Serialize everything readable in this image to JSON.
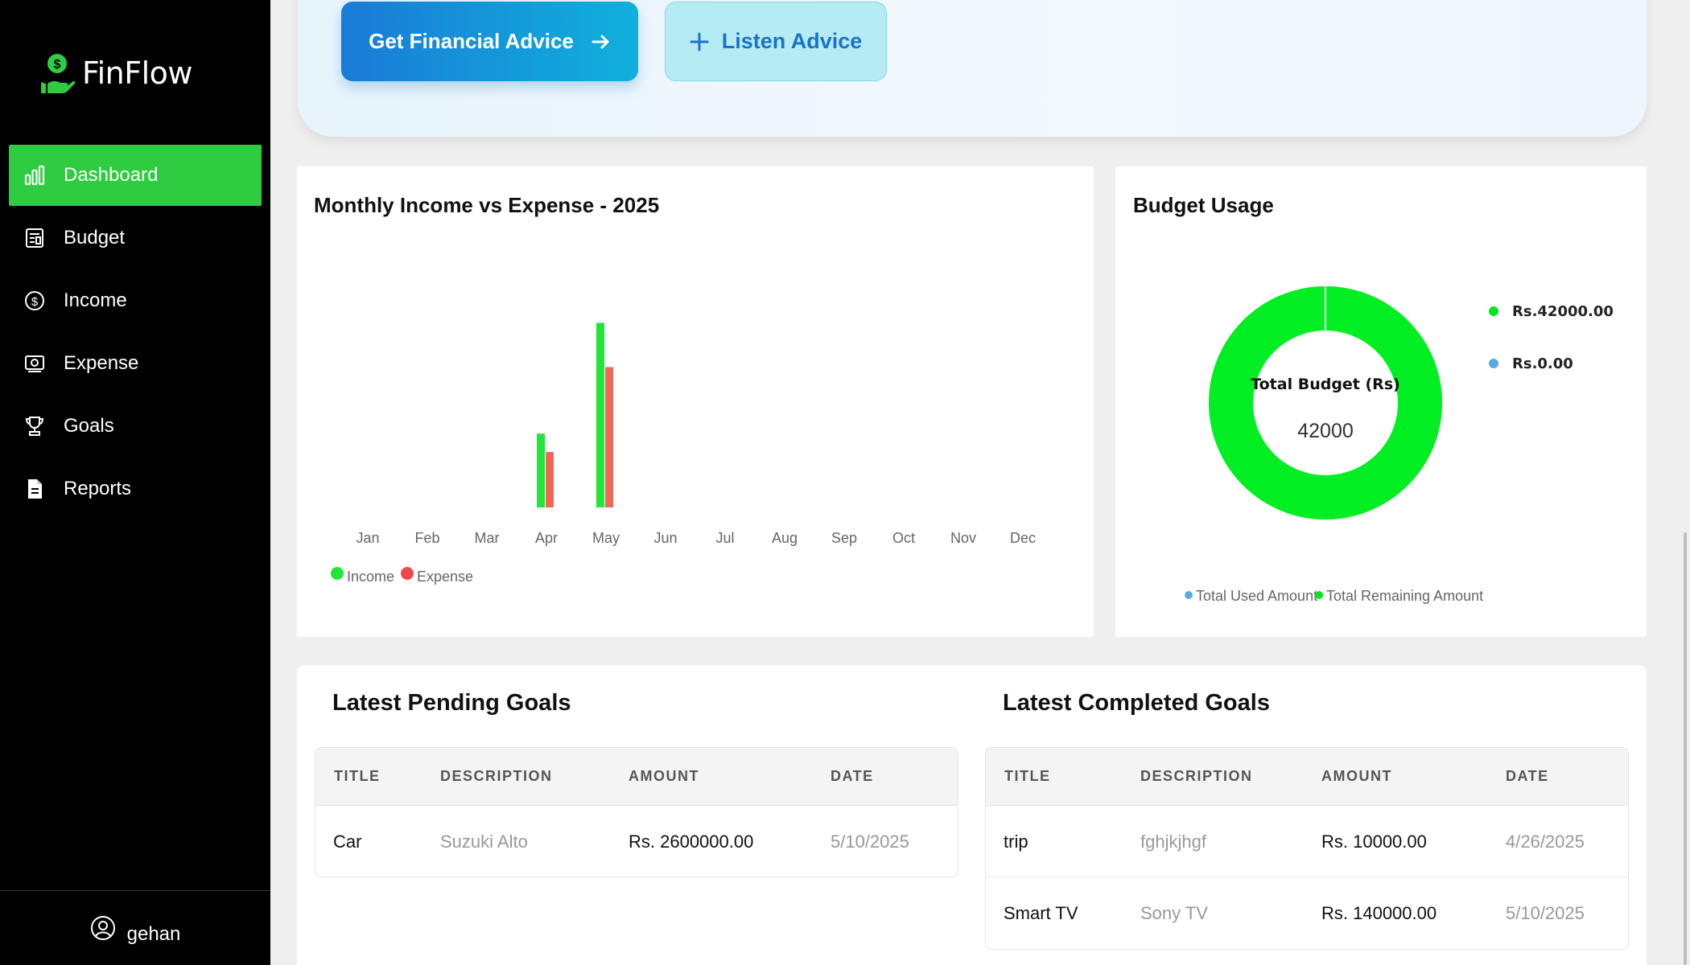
{
  "app": {
    "name": "FinFlow"
  },
  "sidebar": {
    "items": [
      {
        "label": "Dashboard",
        "icon": "bar-chart-icon",
        "active": true
      },
      {
        "label": "Budget",
        "icon": "receipt-icon",
        "active": false
      },
      {
        "label": "Income",
        "icon": "dollar-circle-icon",
        "active": false
      },
      {
        "label": "Expense",
        "icon": "wallet-icon",
        "active": false
      },
      {
        "label": "Goals",
        "icon": "trophy-icon",
        "active": false
      },
      {
        "label": "Reports",
        "icon": "document-icon",
        "active": false
      }
    ],
    "user": "gehan"
  },
  "advice": {
    "get_label": "Get Financial Advice",
    "listen_label": "Listen Advice"
  },
  "income_chart": {
    "title": "Monthly Income vs Expense - 2025",
    "legend": {
      "income": "Income",
      "expense": "Expense"
    }
  },
  "budget_usage": {
    "title": "Budget Usage",
    "center_label": "Total Budget (Rs)",
    "center_value": "42000",
    "legend_right": [
      "Rs.42000.00",
      "Rs.0.00"
    ],
    "legend_bottom": [
      "Total Used Amount",
      "Total Remaining Amount"
    ]
  },
  "colors": {
    "accent_green": "#2ecc40",
    "income_green": "#22e53a",
    "expense_red": "#f0665a",
    "donut_green": "#00ee22",
    "used_blue": "#5aa8e8"
  },
  "chart_data": [
    {
      "type": "bar",
      "title": "Monthly Income vs Expense - 2025",
      "categories": [
        "Jan",
        "Feb",
        "Mar",
        "Apr",
        "May",
        "Jun",
        "Jul",
        "Aug",
        "Sep",
        "Oct",
        "Nov",
        "Dec"
      ],
      "series": [
        {
          "name": "Income",
          "values": [
            0,
            0,
            0,
            40,
            100,
            0,
            0,
            0,
            0,
            0,
            0,
            0
          ]
        },
        {
          "name": "Expense",
          "values": [
            0,
            0,
            0,
            30,
            76,
            0,
            0,
            0,
            0,
            0,
            0,
            0
          ]
        }
      ],
      "ylim": [
        0,
        115
      ],
      "grid": false,
      "legend": "bottom-left"
    },
    {
      "type": "pie",
      "title": "Budget Usage",
      "categories": [
        "Total Used Amount",
        "Total Remaining Amount"
      ],
      "values": [
        0,
        42000
      ],
      "legend": "bottom"
    }
  ],
  "goals": {
    "pending": {
      "title": "Latest Pending Goals",
      "columns": [
        "TITLE",
        "DESCRIPTION",
        "AMOUNT",
        "DATE"
      ],
      "rows": [
        {
          "title": "Car",
          "description": "Suzuki Alto",
          "amount": "Rs. 2600000.00",
          "date": "5/10/2025"
        }
      ]
    },
    "completed": {
      "title": "Latest Completed Goals",
      "columns": [
        "TITLE",
        "DESCRIPTION",
        "AMOUNT",
        "DATE"
      ],
      "rows": [
        {
          "title": "trip",
          "description": "fghjkjhgf",
          "amount": "Rs. 10000.00",
          "date": "4/26/2025"
        },
        {
          "title": "Smart TV",
          "description": "Sony TV",
          "amount": "Rs. 140000.00",
          "date": "5/10/2025"
        }
      ]
    }
  }
}
